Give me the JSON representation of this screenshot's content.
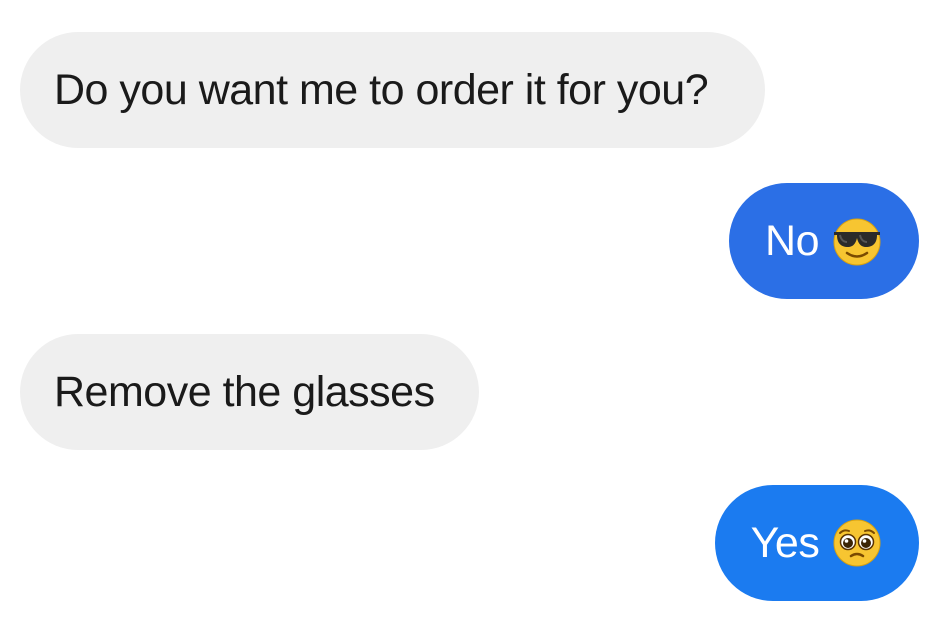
{
  "conversation": {
    "messages": [
      {
        "direction": "incoming",
        "text": "Do you want me to order it for you?",
        "emoji": ""
      },
      {
        "direction": "outgoing",
        "text": "No",
        "emoji": "sunglasses-face-icon"
      },
      {
        "direction": "incoming",
        "text": "Remove the glasses",
        "emoji": ""
      },
      {
        "direction": "outgoing",
        "text": "Yes",
        "emoji": "pleading-face-icon"
      }
    ]
  },
  "colors": {
    "incoming_bubble": "#efefef",
    "incoming_text": "#1a1a1a",
    "outgoing_bubble_1": "#2b6fe6",
    "outgoing_bubble_2": "#1b7bf0",
    "outgoing_text": "#ffffff"
  }
}
